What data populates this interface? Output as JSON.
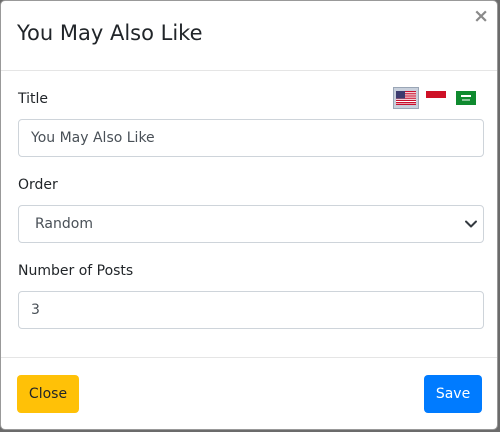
{
  "dialog": {
    "title": "You May Also Like",
    "close_glyph": "×"
  },
  "form": {
    "title_label": "Title",
    "title_value": "You May Also Like",
    "order_label": "Order",
    "order_selected": "Random",
    "posts_label": "Number of Posts",
    "posts_value": "3"
  },
  "languages": [
    {
      "icon": "us-flag-icon",
      "active": true
    },
    {
      "icon": "indonesia-flag-icon",
      "active": false
    },
    {
      "icon": "saudi-flag-icon",
      "active": false
    }
  ],
  "footer": {
    "close_label": "Close",
    "save_label": "Save"
  },
  "colors": {
    "close_button": "#ffc107",
    "save_button": "#007bff"
  }
}
